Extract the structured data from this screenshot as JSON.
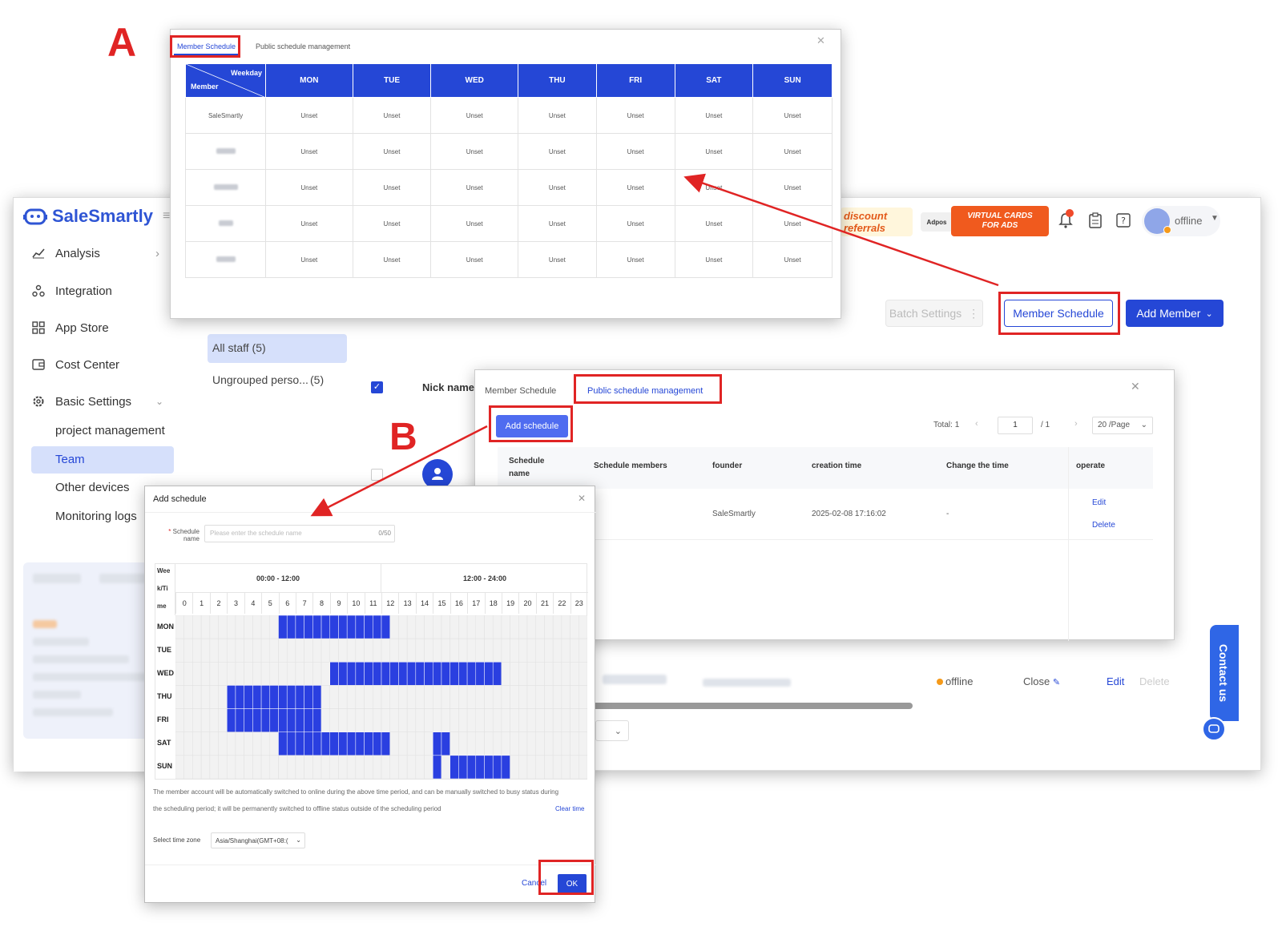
{
  "annotations": {
    "letter_a": "A",
    "letter_b": "B"
  },
  "brand": {
    "name": "SaleSmartly"
  },
  "sidebar": {
    "items": [
      {
        "label": "Analysis",
        "icon": "chart-icon"
      },
      {
        "label": "Integration",
        "icon": "integration-icon"
      },
      {
        "label": "App Store",
        "icon": "grid-icon"
      },
      {
        "label": "Cost Center",
        "icon": "wallet-icon"
      },
      {
        "label": "Basic Settings",
        "icon": "gear-icon"
      }
    ],
    "subitems": [
      "project management",
      "Team",
      "Other devices",
      "Monitoring logs"
    ],
    "active": "Team"
  },
  "groups": [
    {
      "label": "All staff (5)"
    },
    {
      "label": "Ungrouped perso...",
      "count": "(5)"
    }
  ],
  "topbar": {
    "promo1_line1": "discount",
    "promo1_line2": "referrals",
    "promo2": "Adpos",
    "promo3_line1": "VIRTUAL CARDS",
    "promo3_line2": "FOR ADS",
    "status": "offline"
  },
  "actions": {
    "batch_settings": "Batch Settings",
    "member_schedule": "Member Schedule",
    "add_member": "Add Member"
  },
  "team_table": {
    "nick_name_header": "Nick name",
    "row_status": "offline",
    "row_close": "Close",
    "row_edit": "Edit",
    "row_delete": "Delete"
  },
  "contact_us": "Contact us",
  "panel_a": {
    "tab_active": "Member Schedule",
    "tab_inactive": "Public schedule management",
    "corner_top": "Weekday",
    "corner_bottom": "Member",
    "days": [
      "MON",
      "TUE",
      "WED",
      "THU",
      "FRI",
      "SAT",
      "SUN"
    ],
    "first_member": "SaleSmartly",
    "cell_value": "Unset",
    "row_count": 5
  },
  "panel_b": {
    "tab_inactive": "Member Schedule",
    "tab_active": "Public schedule management",
    "add_button": "Add schedule",
    "total_label": "Total:",
    "total_value": "1",
    "page_current": "1",
    "page_total": "/ 1",
    "page_size": "20 /Page",
    "columns": [
      "Schedule name",
      "Schedule members",
      "founder",
      "creation time",
      "Change the time",
      "operate"
    ],
    "row": {
      "founder": "SaleSmartly",
      "creation_time": "2025-02-08 17:16:02",
      "change_time": "-",
      "edit": "Edit",
      "delete": "Delete"
    }
  },
  "add_dialog": {
    "title": "Add schedule",
    "name_label_line1": "Schedule",
    "name_label_line2": "name",
    "name_placeholder": "Please enter the schedule name",
    "name_counter": "0/50",
    "week_header_lines": [
      "Wee",
      "k/Ti",
      "me"
    ],
    "range_am": "00:00 - 12:00",
    "range_pm": "12:00 - 24:00",
    "hours": [
      "0",
      "1",
      "2",
      "3",
      "4",
      "5",
      "6",
      "7",
      "8",
      "9",
      "10",
      "11",
      "12",
      "13",
      "14",
      "15",
      "16",
      "17",
      "18",
      "19",
      "20",
      "21",
      "22",
      "23"
    ],
    "days": [
      "MON",
      "TUE",
      "WED",
      "THU",
      "FRI",
      "SAT",
      "SUN"
    ],
    "selections": {
      "MON": [
        [
          6,
          12.5
        ]
      ],
      "TUE": [],
      "WED": [
        [
          9,
          19
        ]
      ],
      "THU": [
        [
          3,
          8.5
        ]
      ],
      "FRI": [
        [
          3,
          8.5
        ]
      ],
      "SAT": [
        [
          6,
          12.5
        ],
        [
          15,
          16
        ]
      ],
      "SUN": [
        [
          15,
          15.5
        ],
        [
          16,
          19.5
        ]
      ]
    },
    "note_line1": "The member account will be automatically switched to online during the above time period, and can be manually switched to busy status during",
    "note_line2": "the scheduling period; it will be permanently switched to offline status outside of the scheduling period",
    "clear_time": "Clear time",
    "timezone_label": "Select time zone",
    "timezone_value": "Asia/Shanghai(GMT+08:(",
    "cancel": "Cancel",
    "ok": "OK"
  },
  "colors": {
    "primary": "#2547d6",
    "annotation_red": "#e02424",
    "selected_slot": "#2a3fe0"
  }
}
